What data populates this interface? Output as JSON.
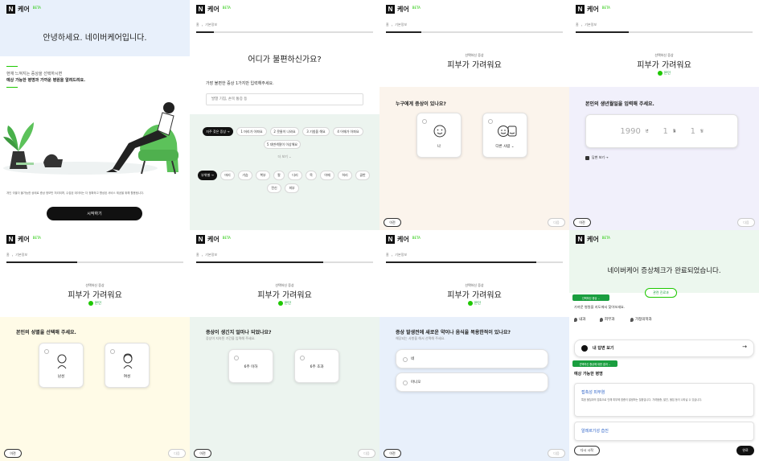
{
  "app": {
    "logo_text": "케어",
    "beta": "BETA"
  },
  "colors": {
    "accent": "#1ec800",
    "dark": "#111111",
    "blue_bg": "#e8f0fb",
    "mint_bg": "#ecf4ef",
    "peach_bg": "#fbf4ec",
    "lavender_bg": "#f1f0fb",
    "cream_bg": "#fffbe7"
  },
  "icons": {
    "home": "home-icon",
    "arrow": "arrow-right-icon",
    "smile": "smile-face-icon"
  },
  "p1": {
    "greeting": "안녕하세요. 네이버케어입니다.",
    "desc1": "현재 느껴지는 증상을 선택하시면",
    "desc2": "예상 가능한 병명과 가까운 병원을 알려드려요.",
    "consent": "개인 식별이 불가능한 상태로 증상 정보만 처리되며, 수집된 데이터는 더 정확하고 향상된 서비스 제공을 위해 활용됩니다.",
    "start": "시작하기"
  },
  "crumb": {
    "home": "홈",
    "basic": "기본정보"
  },
  "p2": {
    "title": "어디가 불편하신가요?",
    "prompt": "가장 불편한 증상 1가지만 입력해주세요.",
    "placeholder": "발열 기침, 손목 통증 등",
    "chips1": [
      "자주 찾은 증상 →",
      "1 머리가 아파요",
      "2 콧물이 나와요",
      "3 기침을 해요",
      "4 어깨가 아파요"
    ],
    "chips2": [
      "5 대변색깔이 이상해요"
    ],
    "more": "더 보기 ⌄",
    "body_btn": "부위별 →",
    "body_chips": [
      "머리",
      "가슴",
      "복부",
      "팔",
      "다리",
      "목",
      "어깨",
      "허리",
      "골반",
      "전신",
      "피부"
    ]
  },
  "selected": {
    "label": "선택하신 증상",
    "symptom": "피부가 가려워요",
    "self": "본인"
  },
  "p3": {
    "question": "누구에게 증상이 있나요?",
    "me": "나",
    "other": "다른 사람 ⌄"
  },
  "p4": {
    "question": "본인의 생년월일을 입력해 주세요.",
    "year": "1990",
    "year_u": "년",
    "month": "1",
    "month_u": "월",
    "day": "1",
    "day_u": "일",
    "answers": "답변 보기 →"
  },
  "p5": {
    "question": "본인의 성별을 선택해 주세요.",
    "male": "남성",
    "female": "여성"
  },
  "p6": {
    "question": "증상이 생긴지 얼마나 되었나요?",
    "hint": "증상이 지속된 기간을 입력해 주세요.",
    "opt1": "6주 이하",
    "opt2": "6주 초과"
  },
  "p7": {
    "question": "증상 발생전에 새로운 약이나 음식을 복용한적이 있나요?",
    "hint": "해당되는 사항을 해서 선택해 주세요.",
    "yes": "네",
    "no": "아니오"
  },
  "p8": {
    "title": "네이버케어 증상체크가 완료되었습니다.",
    "related": "관련 진료과",
    "tag1": "선택하신 증상 ⌄",
    "nearby": "가까운 병원을 지도에서 찾아보세요.",
    "depts": [
      "내과",
      "피부과",
      "가정의학과"
    ],
    "my_answers": "내 답변 보기",
    "tag2": "선택하신 증상에 대한 결과 ⌄",
    "possible": "예상 가능한 병명",
    "d1_title": "접촉성 피부염",
    "d1_desc": "특정 물질과의 접촉으로 인해 피부에 염증이 발생하는 질환입니다. 가려움증, 발진, 물집 등이 나타날 수 있습니다.",
    "d2_title": "알레르기성 습진",
    "retry": "다시 시작",
    "done": "완료"
  },
  "nav": {
    "prev": "이전",
    "next": "다음"
  }
}
